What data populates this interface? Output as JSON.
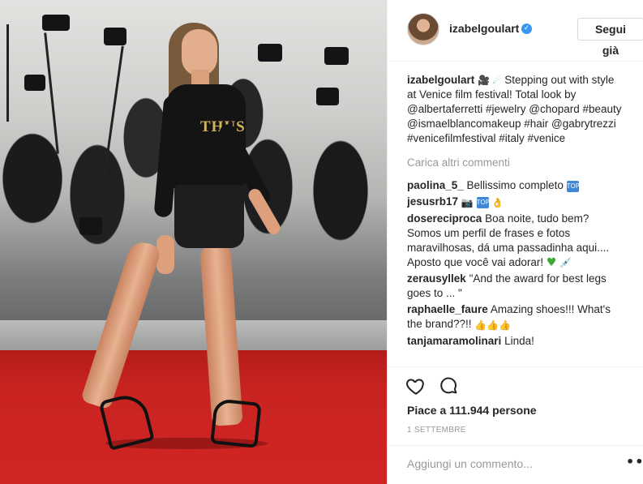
{
  "post": {
    "username": "izabelgoulart",
    "follow_button": "Segui già",
    "photo_print": "THUS",
    "caption_text": "Stepping out with style at Venice film festival! Total look by @albertaferretti #jewelry @chopard #beauty @ismaelblancomakeup #hair @gabrytrezzi #venicefilmfestival #italy #venice",
    "load_more": "Carica altri commenti",
    "likes_text": "Piace a 111.944 persone",
    "date": "1 SETTEMBRE",
    "comment_placeholder": "Aggiungi un commento..."
  },
  "comments": [
    {
      "user": "paolina_5_",
      "text": "Bellissimo completo"
    },
    {
      "user": "jesusrb17",
      "text": ""
    },
    {
      "user": "dosereciproca",
      "text": "Boa noite, tudo bem? Somos um perfil de frases e fotos maravilhosas,  dá uma passadinha aqui.... Aposto que você vai adorar!"
    },
    {
      "user": "zerausyllek",
      "text": "\"And the award for best legs goes to ... \""
    },
    {
      "user": "raphaelle_faure",
      "text": "Amazing shoes!!! What's the brand??!!"
    },
    {
      "user": "tanjamaramolinari",
      "text": "Linda!"
    }
  ],
  "icons": {
    "verified": "verified-badge-icon",
    "like": "heart-outline-icon",
    "comment": "comment-bubble-icon",
    "more": "more-options-icon"
  },
  "colors": {
    "verified_blue": "#3897f0",
    "muted_text": "#999999",
    "border": "#efefef",
    "carpet_red": "#c92321"
  }
}
